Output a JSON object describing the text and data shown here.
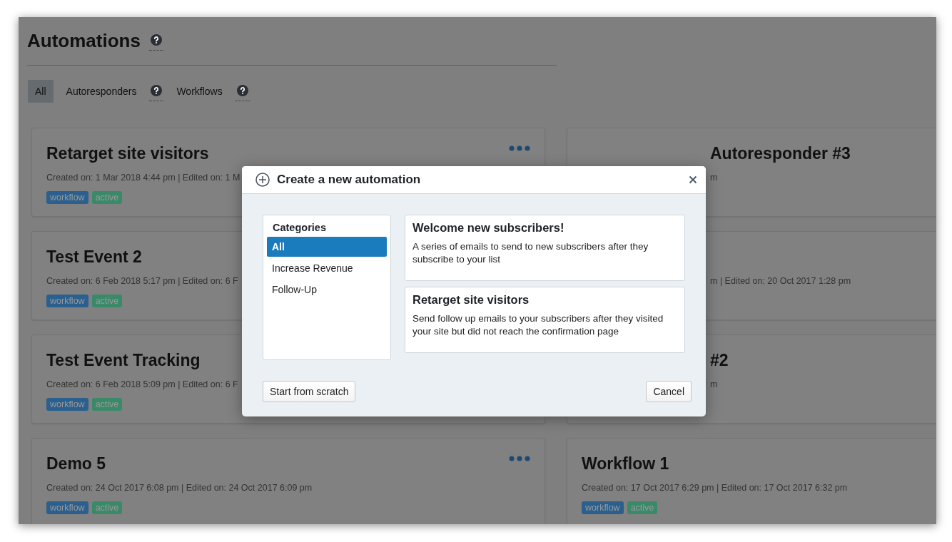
{
  "page": {
    "title": "Automations"
  },
  "filters": [
    {
      "label": "All",
      "selected": true,
      "help": false
    },
    {
      "label": "Autoresponders",
      "selected": false,
      "help": true
    },
    {
      "label": "Workflows",
      "selected": false,
      "help": true
    }
  ],
  "cards": [
    {
      "title": "Retarget site visitors",
      "meta": "Created on: 1 Mar 2018 4:44 pm | Edited on: 1 M",
      "menu": true,
      "covered": false,
      "tags": [
        {
          "label": "workflow",
          "color": "#2a5f8e"
        },
        {
          "label": "active",
          "color": "#3a8a6a"
        }
      ]
    },
    {
      "title": "Autoresponder #3",
      "meta": "m",
      "menu": false,
      "covered": true
    },
    {
      "title": "Test Event 2",
      "meta": "Created on: 6 Feb 2018 5:17 pm | Edited on: 6 F",
      "menu": false,
      "covered": false,
      "tags": [
        {
          "label": "workflow",
          "color": "#2a5f8e"
        },
        {
          "label": "active",
          "color": "#3a8a6a"
        }
      ]
    },
    {
      "meta": "m | Edited on: 20 Oct 2017 1:28 pm",
      "menu": false,
      "covered": true
    },
    {
      "title": "Test Event Tracking",
      "meta": "Created on: 6 Feb 2018 5:09 pm | Edited on: 6 F",
      "menu": false,
      "covered": false,
      "tags": [
        {
          "label": "workflow",
          "color": "#2a5f8e"
        },
        {
          "label": "active",
          "color": "#3a8a6a"
        }
      ]
    },
    {
      "title": "#2",
      "meta": "m",
      "menu": false,
      "covered": true
    },
    {
      "title": "Demo 5",
      "meta": "Created on: 24 Oct 2017 6:08 pm | Edited on: 24 Oct 2017 6:09 pm",
      "menu": true,
      "covered": false,
      "tags": [
        {
          "label": "workflow",
          "color": "#2a5f8e"
        },
        {
          "label": "active",
          "color": "#3a8a6a"
        }
      ]
    },
    {
      "title": "Workflow 1",
      "meta": "Created on: 17 Oct 2017 6:29 pm | Edited on: 17 Oct 2017 6:32 pm",
      "menu": false,
      "covered": false,
      "tags": [
        {
          "label": "workflow",
          "color": "#2a5f8e"
        },
        {
          "label": "active",
          "color": "#3a8a6a"
        }
      ]
    }
  ],
  "modal": {
    "title": "Create a new automation",
    "categories_heading": "Categories",
    "categories": [
      {
        "label": "All",
        "selected": true
      },
      {
        "label": "Increase Revenue",
        "selected": false
      },
      {
        "label": "Follow-Up",
        "selected": false
      }
    ],
    "templates": [
      {
        "title": "Welcome new subscribers!",
        "description": "A series of emails to send to new subscribers after they subscribe to your list"
      },
      {
        "title": "Retarget site visitors",
        "description": "Send follow up emails to your subscribers after they visited your site but did not reach the confirmation page"
      }
    ],
    "buttons": [
      "Start from scratch",
      "Cancel"
    ]
  }
}
